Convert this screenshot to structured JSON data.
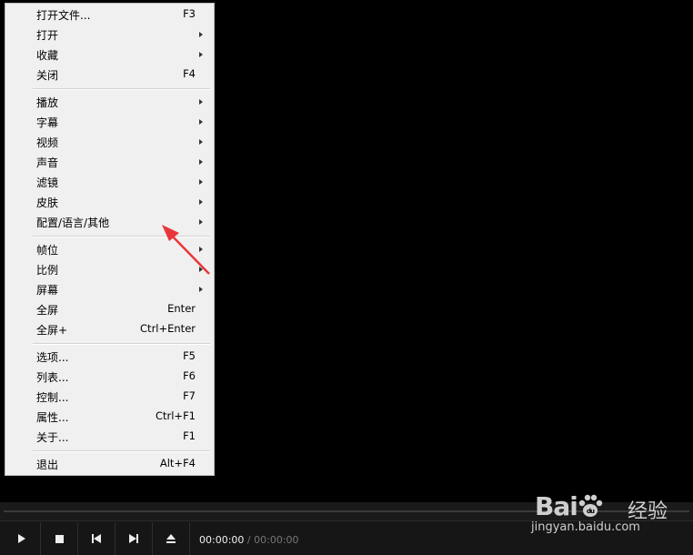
{
  "menu": {
    "items": [
      {
        "label": "打开文件...",
        "shortcut": "F3",
        "submenu": false
      },
      {
        "label": "打开",
        "shortcut": "",
        "submenu": true
      },
      {
        "label": "收藏",
        "shortcut": "",
        "submenu": true
      },
      {
        "label": "关闭",
        "shortcut": "F4",
        "submenu": false
      },
      {
        "label": "播放",
        "shortcut": "",
        "submenu": true
      },
      {
        "label": "字幕",
        "shortcut": "",
        "submenu": true
      },
      {
        "label": "视频",
        "shortcut": "",
        "submenu": true
      },
      {
        "label": "声音",
        "shortcut": "",
        "submenu": true
      },
      {
        "label": "滤镜",
        "shortcut": "",
        "submenu": true
      },
      {
        "label": "皮肤",
        "shortcut": "",
        "submenu": true
      },
      {
        "label": "配置/语言/其他",
        "shortcut": "",
        "submenu": true
      },
      {
        "label": "帧位",
        "shortcut": "",
        "submenu": true
      },
      {
        "label": "比例",
        "shortcut": "",
        "submenu": true
      },
      {
        "label": "屏幕",
        "shortcut": "",
        "submenu": true
      },
      {
        "label": "全屏",
        "shortcut": "Enter",
        "submenu": false
      },
      {
        "label": "全屏+",
        "shortcut": "Ctrl+Enter",
        "submenu": false
      },
      {
        "label": "选项...",
        "shortcut": "F5",
        "submenu": false
      },
      {
        "label": "列表...",
        "shortcut": "F6",
        "submenu": false
      },
      {
        "label": "控制...",
        "shortcut": "F7",
        "submenu": false
      },
      {
        "label": "属性...",
        "shortcut": "Ctrl+F1",
        "submenu": false
      },
      {
        "label": "关于...",
        "shortcut": "F1",
        "submenu": false
      },
      {
        "label": "退出",
        "shortcut": "Alt+F4",
        "submenu": false
      }
    ]
  },
  "controls": {
    "play_icon": "play-icon",
    "stop_icon": "stop-icon",
    "prev_icon": "previous-icon",
    "next_icon": "next-icon",
    "eject_icon": "eject-icon",
    "current_time": "00:00:00",
    "separator": "/",
    "total_time": "00:00:00"
  },
  "watermark": {
    "brand": "Bai",
    "brand_suffix": "du",
    "text": "经验",
    "url": "jingyan.baidu.com"
  },
  "colors": {
    "menu_bg": "#f0f0f0",
    "annotation_arrow": "#e8363a",
    "control_bar": "#161616"
  }
}
